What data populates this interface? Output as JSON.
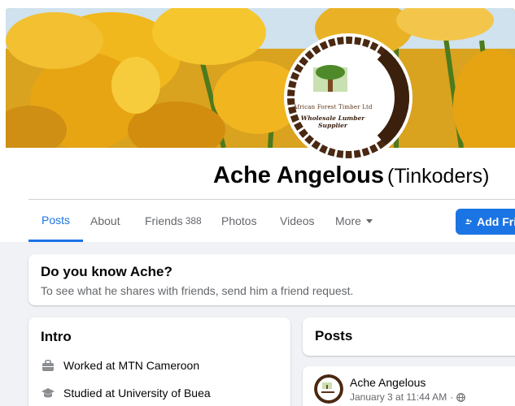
{
  "cover": {
    "icon": "tulip-field-cover-photo"
  },
  "avatar": {
    "logo_line1": "African Forest Timber Ltd",
    "logo_line2": "Wholesale Lumber Supplier"
  },
  "profile": {
    "name": "Ache Angelous",
    "alternate_name": "(Tinkoders)"
  },
  "tabs": [
    {
      "label": "Posts",
      "active": true
    },
    {
      "label": "About"
    },
    {
      "label": "Friends",
      "count": "388"
    },
    {
      "label": "Photos"
    },
    {
      "label": "Videos"
    },
    {
      "label": "More"
    }
  ],
  "actions": {
    "add_friend": "Add Friend"
  },
  "know_card": {
    "title": "Do you know Ache?",
    "subtitle": "To see what he shares with friends, send him a friend request."
  },
  "intro": {
    "title": "Intro",
    "items": [
      {
        "icon": "briefcase-icon",
        "prefix": "Worked at",
        "value": "MTN Cameroon"
      },
      {
        "icon": "graduation-cap-icon",
        "prefix": "Studied at",
        "value": "University of Buea"
      }
    ]
  },
  "posts": {
    "title": "Posts",
    "first_post": {
      "author": "Ache Angelous",
      "time": "January 3 at 11:44 AM",
      "separator": "·",
      "audience_icon": "globe-icon"
    }
  },
  "colors": {
    "accent": "#1b74e4",
    "background": "#f0f2f5",
    "logo_brown": "#5a3418"
  }
}
